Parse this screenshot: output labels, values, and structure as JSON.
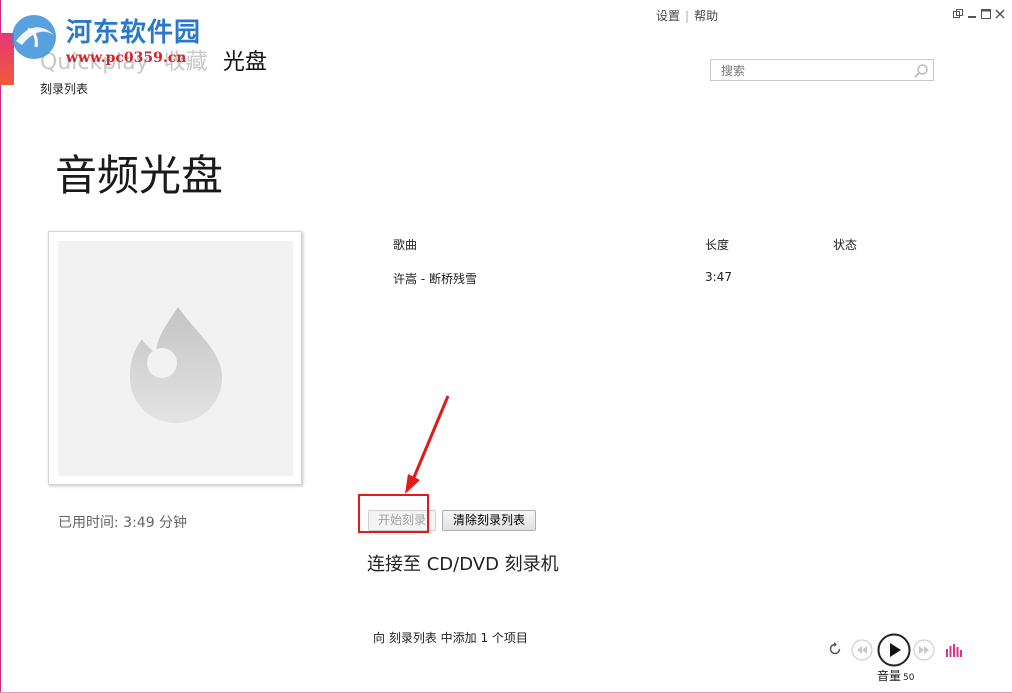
{
  "watermark": {
    "title": "河东软件园",
    "url": "www.pc0359.cn"
  },
  "breadcrumb": {
    "items": [
      "Quickplay",
      "收藏"
    ],
    "current": "光盘"
  },
  "subnav": {
    "label": "刻录列表"
  },
  "topmenu": {
    "settings": "设置",
    "help": "帮助"
  },
  "search": {
    "placeholder": "搜索"
  },
  "page": {
    "title": "音频光盘",
    "used_time": "已用时间: 3:49 分钟"
  },
  "table": {
    "headers": {
      "song": "歌曲",
      "length": "长度",
      "status": "状态"
    },
    "rows": [
      {
        "song": "许嵩 - 断桥残雪",
        "length": "3:47",
        "status": ""
      }
    ]
  },
  "buttons": {
    "start_burn": "开始刻录",
    "clear_list": "清除刻录列表"
  },
  "messages": {
    "connect": "连接至 CD/DVD 刻录机",
    "status": "向 刻录列表 中添加 1 个项目"
  },
  "player": {
    "volume_label": "音量",
    "volume_value": "50"
  },
  "colors": {
    "accent": "#e8357a",
    "highlight": "#e21a1a",
    "watermark_blue": "#2c78c8",
    "watermark_red": "#d0262e",
    "equalizer": "#d8368a"
  },
  "icons": [
    "refresh-icon",
    "rewind-icon",
    "play-icon",
    "fast-forward-icon",
    "equalizer-icon",
    "search-icon",
    "flame-icon",
    "restore-icon",
    "minimize-icon",
    "maximize-icon",
    "close-icon"
  ]
}
